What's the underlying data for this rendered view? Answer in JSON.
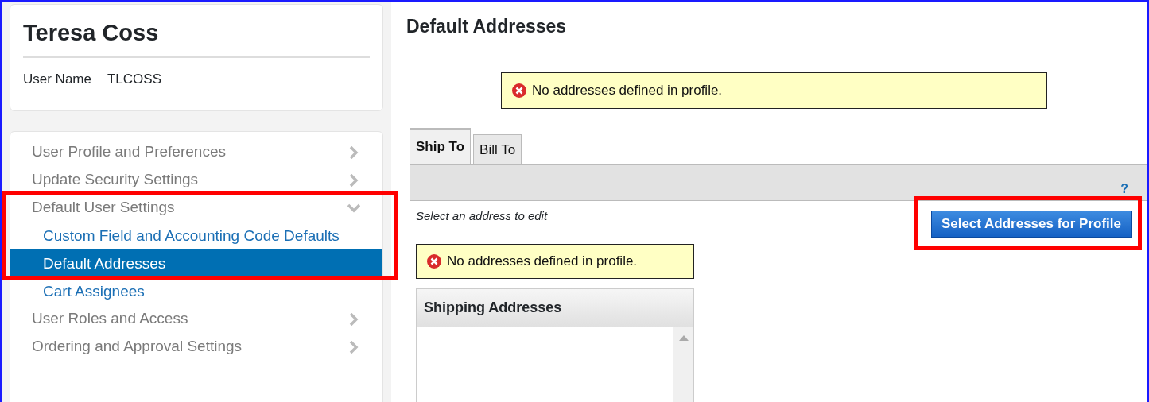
{
  "profile": {
    "name": "Teresa Coss",
    "user_name_label": "User Name",
    "user_name": "TLCOSS"
  },
  "sidebar": {
    "items": [
      {
        "label": "User Profile and Preferences",
        "expanded": false
      },
      {
        "label": "Update Security Settings",
        "expanded": false
      },
      {
        "label": "Default User Settings",
        "expanded": true,
        "children": [
          {
            "label": "Custom Field and Accounting Code Defaults",
            "selected": false
          },
          {
            "label": "Default Addresses",
            "selected": true
          },
          {
            "label": "Cart Assignees",
            "selected": false
          }
        ]
      },
      {
        "label": "User Roles and Access",
        "expanded": false
      },
      {
        "label": "Ordering and Approval Settings",
        "expanded": false
      }
    ]
  },
  "main": {
    "title": "Default Addresses",
    "alert": "No addresses defined in profile.",
    "tabs": [
      {
        "label": "Ship To",
        "selected": true
      },
      {
        "label": "Bill To",
        "selected": false
      }
    ],
    "help": "?",
    "hint": "Select an address to edit",
    "button": "Select Addresses for Profile",
    "inner_alert": "No addresses defined in profile.",
    "list_title": "Shipping Addresses"
  }
}
